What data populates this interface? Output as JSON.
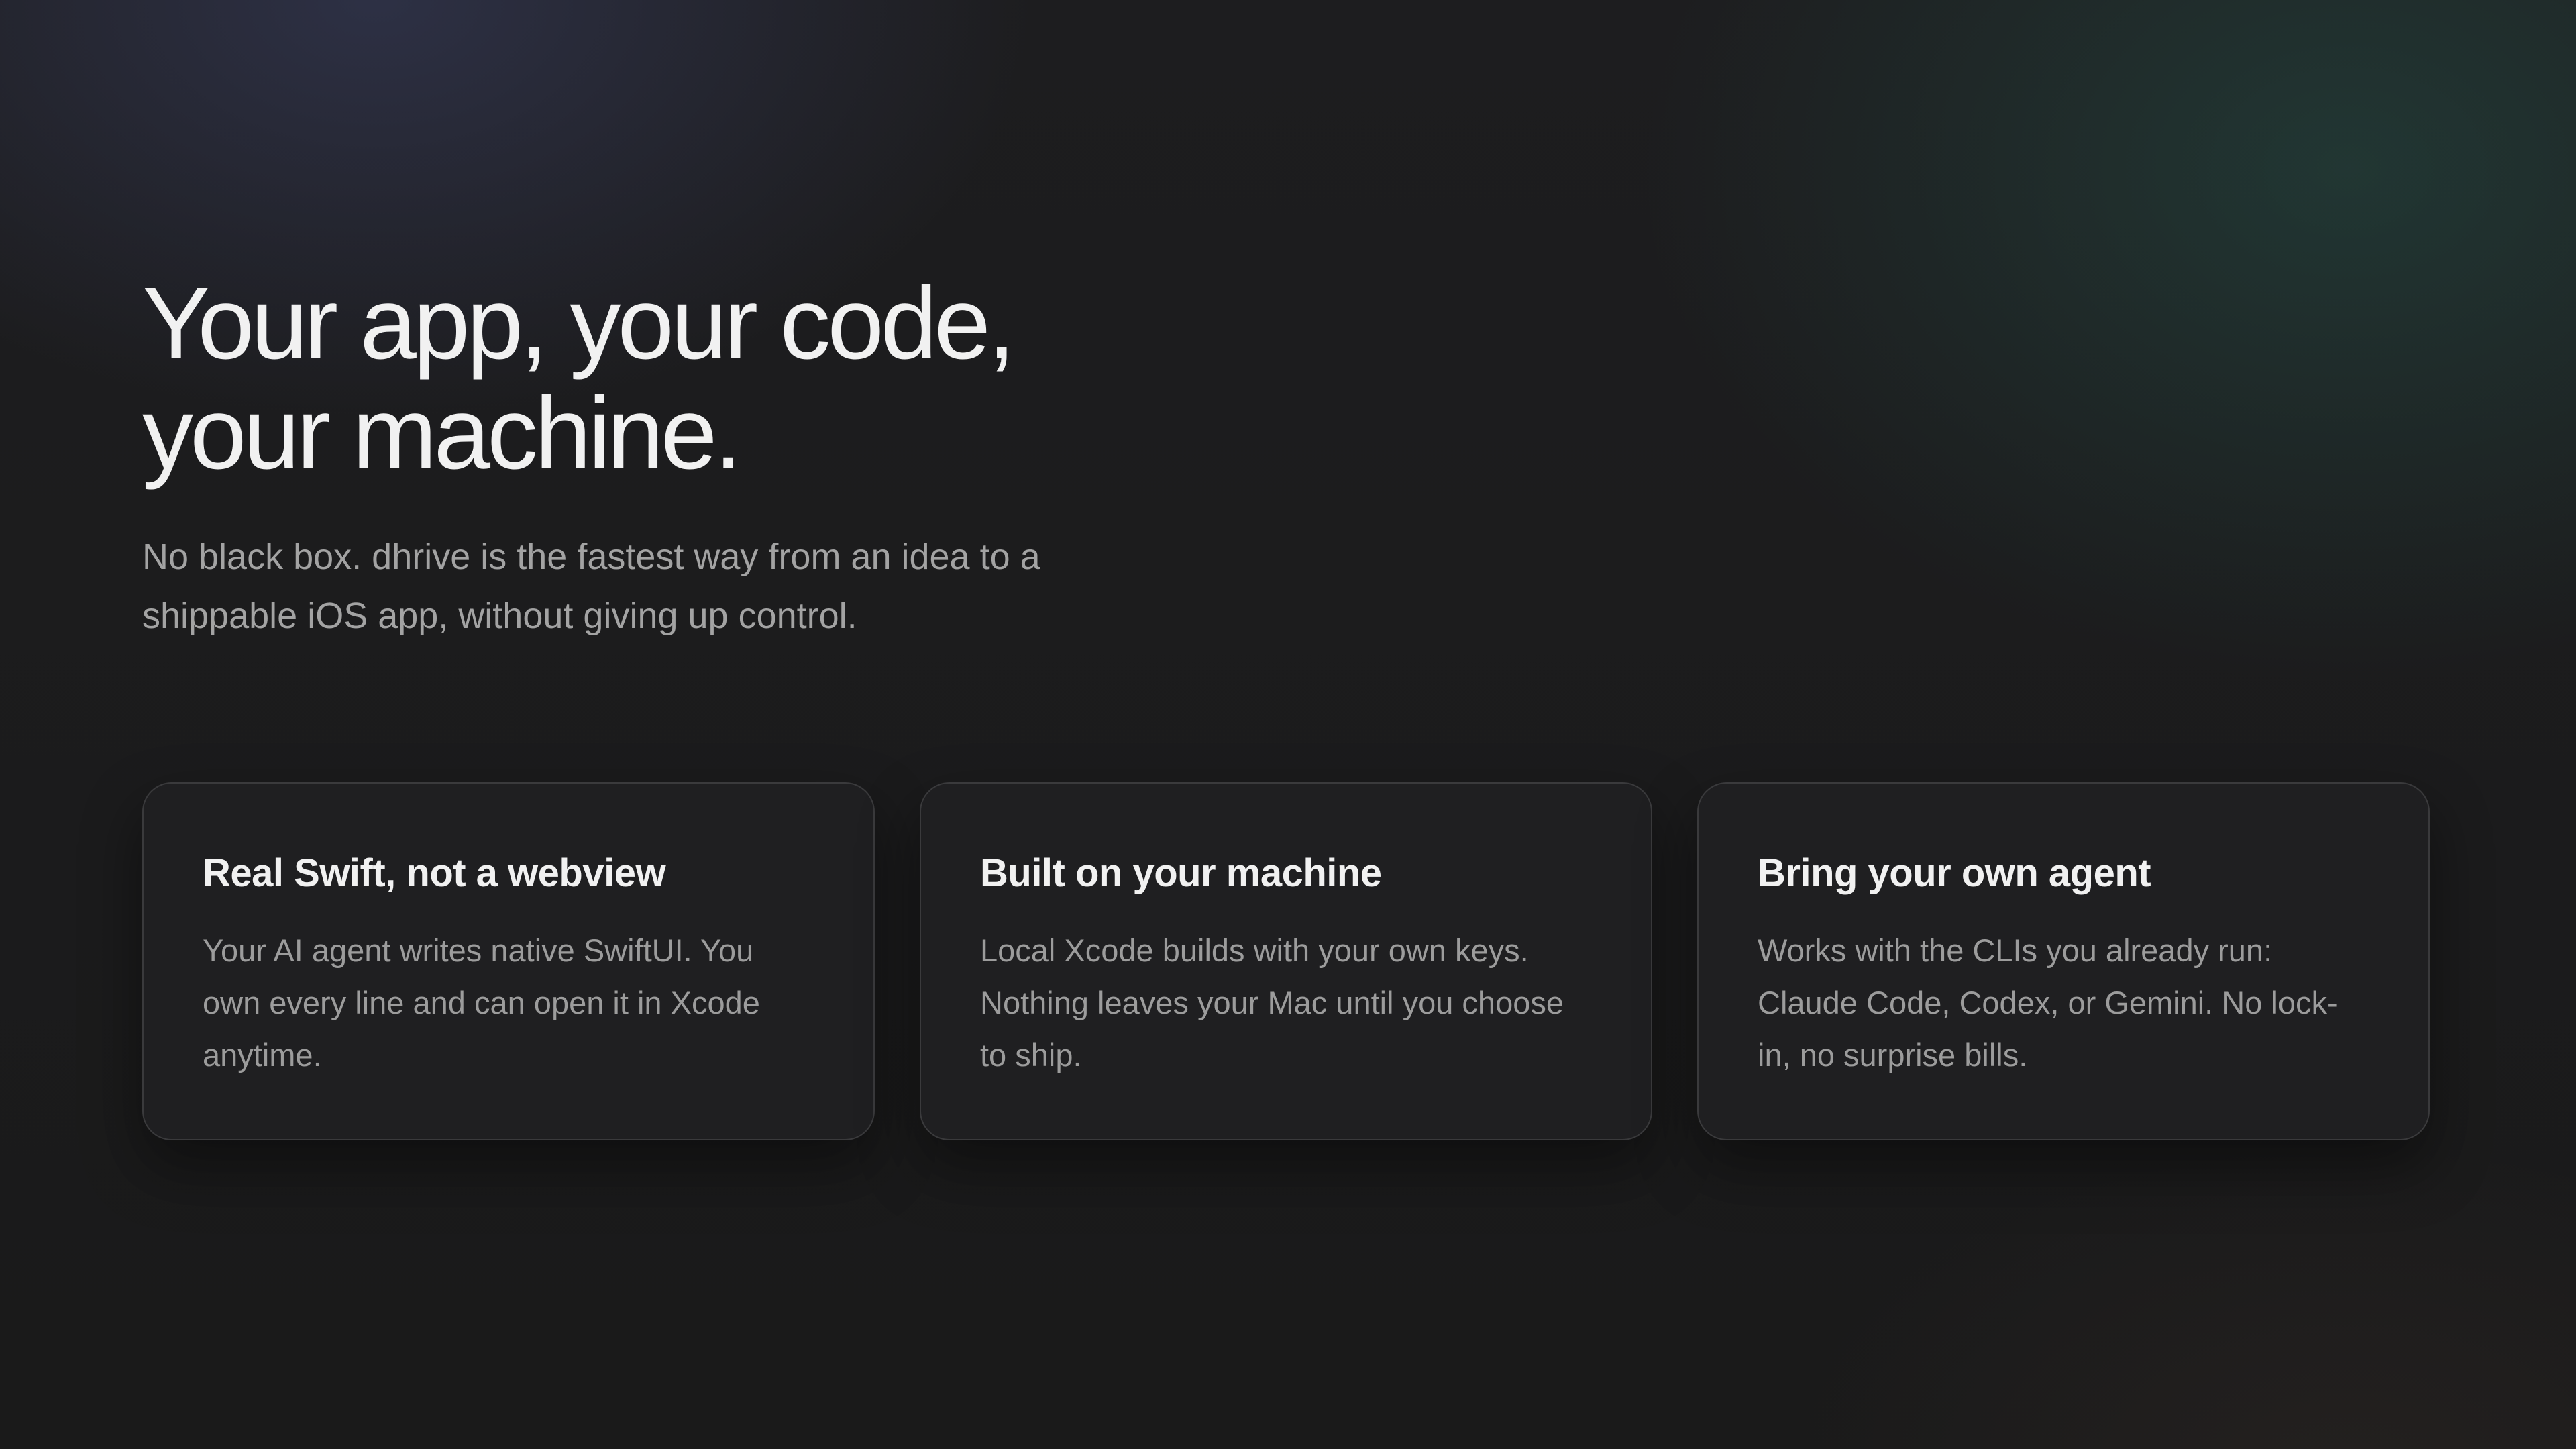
{
  "hero": {
    "headline_line1": "Your app, your code,",
    "headline_line2": "your machine.",
    "description": "No black box. dhrive is the fastest way from an idea to a shippable iOS app, without giving up control."
  },
  "features": [
    {
      "title": "Real Swift, not a webview",
      "text": "Your AI agent writes native SwiftUI. You own every line and can open it in Xcode anytime."
    },
    {
      "title": "Built on your machine",
      "text": "Local Xcode builds with your own keys. Nothing leaves your Mac until you choose to ship."
    },
    {
      "title": "Bring your own agent",
      "text": "Works with the CLIs you already run: Claude Code, Codex, or Gemini. No lock-in, no surprise bills."
    }
  ],
  "colors": {
    "background": "#1a1a1b",
    "card_background": "#1f1f21",
    "card_border": "#3a3a3c",
    "heading": "#f1f1f1",
    "body_text": "#a3a3a3"
  }
}
